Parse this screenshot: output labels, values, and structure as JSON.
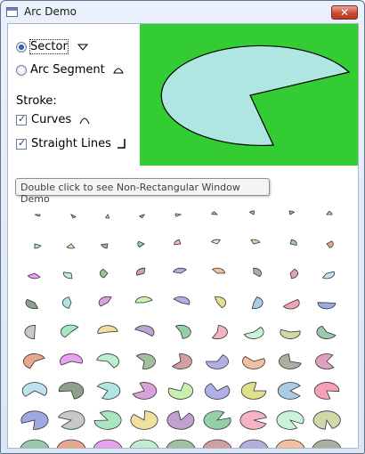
{
  "window": {
    "title": "Arc Demo",
    "close_glyph": "✕"
  },
  "options": {
    "sector_label": "Sector",
    "arc_segment_label": "Arc Segment",
    "stroke_label": "Stroke:",
    "curves_label": "Curves",
    "straight_lines_label": "Straight Lines",
    "selected": "sector",
    "curves_checked": true,
    "straight_lines_checked": true
  },
  "preview": {
    "background": "#33cc33",
    "fill": "#b0e6e2"
  },
  "tooltip": {
    "text": "Double click to see Non-Rectangular Window Demo"
  },
  "icons": [
    "sector-icon",
    "arc-segment-icon",
    "curve-icon",
    "straight-lines-icon"
  ],
  "colors": {
    "palette": [
      "#b0e6e2",
      "#d9a3d9",
      "#c9f0b0",
      "#b0b0e8",
      "#e0e08a",
      "#a9cbe4",
      "#f3a3b5",
      "#9ea8e2",
      "#c8c8c8",
      "#a7e6bf",
      "#f0e0a0",
      "#c0a0d0",
      "#93d0a8",
      "#f7b3c3",
      "#ccf2d9",
      "#d0d8a8",
      "#99c9a9",
      "#e8a88a",
      "#e8a0f0",
      "#bdeed0",
      "#a0c0a0",
      "#d0a0a0",
      "#b0b0e0",
      "#f0c0a0",
      "#a9b0a0",
      "#e0a0c0",
      "#c0e0f0",
      "#8fa08f"
    ]
  }
}
